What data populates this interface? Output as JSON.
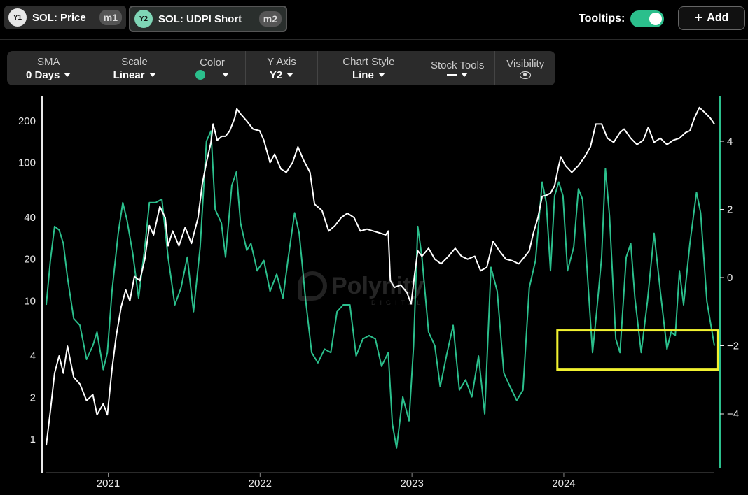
{
  "header": {
    "series1": {
      "badge": "Y1",
      "label": "SOL: Price",
      "metric": "m1"
    },
    "series2": {
      "badge": "Y2",
      "label": "SOL: UDPI Short",
      "metric": "m2"
    },
    "tooltips_label": "Tooltips:",
    "tooltips_on": true,
    "add_label": "Add",
    "add_icon": "plus-icon"
  },
  "controls": [
    {
      "label": "SMA",
      "value": "0 Days"
    },
    {
      "label": "Scale",
      "value": "Linear"
    },
    {
      "label": "Color",
      "value": ""
    },
    {
      "label": "Y Axis",
      "value": "Y2"
    },
    {
      "label": "Chart Style",
      "value": "Line"
    },
    {
      "label": "Stock Tools",
      "value": ""
    },
    {
      "label": "Visibility",
      "value": ""
    }
  ],
  "colors": {
    "accent": "#2bbf8c",
    "price_line": "#ffffff",
    "udpi_line": "#2bbf8c",
    "highlight_box": "#f2f230",
    "background": "#000000"
  },
  "watermark": {
    "text": "Polynity",
    "subtext": "DIGITAL"
  },
  "chart_data": {
    "type": "line",
    "x_ticks": [
      "2021",
      "2022",
      "2023",
      "2024"
    ],
    "y1_axis": {
      "scale": "log",
      "ticks": [
        "1",
        "2",
        "4",
        "10",
        "20",
        "40",
        "100",
        "200"
      ],
      "range": [
        0.85,
        300
      ]
    },
    "y2_axis": {
      "scale": "linear",
      "ticks": [
        "4",
        "2",
        "0",
        "-2",
        "-4"
      ],
      "range": [
        -5.5,
        5.3
      ]
    },
    "grid": false,
    "highlight": {
      "x_range": [
        "2023-12-25",
        "2024-11-25"
      ],
      "y2_range": [
        -2.7,
        -1.55
      ]
    },
    "series": [
      {
        "axis": "y1",
        "points": [
          [
            "2020-08-05",
            0.9
          ],
          [
            "2020-08-15",
            1.6
          ],
          [
            "2020-08-25",
            3.0
          ],
          [
            "2020-09-05",
            4.0
          ],
          [
            "2020-09-15",
            3.0
          ],
          [
            "2020-09-25",
            4.7
          ],
          [
            "2020-10-10",
            2.8
          ],
          [
            "2020-10-25",
            2.5
          ],
          [
            "2020-11-10",
            1.9
          ],
          [
            "2020-11-25",
            2.1
          ],
          [
            "2020-12-05",
            1.5
          ],
          [
            "2020-12-20",
            1.8
          ],
          [
            "2020-12-30",
            1.5
          ],
          [
            "2021-01-10",
            3.2
          ],
          [
            "2021-01-20",
            5.5
          ],
          [
            "2021-02-01",
            9.0
          ],
          [
            "2021-02-12",
            12.0
          ],
          [
            "2021-02-22",
            10.0
          ],
          [
            "2021-03-05",
            15.0
          ],
          [
            "2021-03-18",
            14.0
          ],
          [
            "2021-03-30",
            20.0
          ],
          [
            "2021-04-10",
            35.0
          ],
          [
            "2021-04-20",
            30.0
          ],
          [
            "2021-05-05",
            48.0
          ],
          [
            "2021-05-18",
            40.0
          ],
          [
            "2021-05-25",
            25.0
          ],
          [
            "2021-06-05",
            32.0
          ],
          [
            "2021-06-20",
            25.0
          ],
          [
            "2021-07-05",
            34.0
          ],
          [
            "2021-07-20",
            26.0
          ],
          [
            "2021-08-05",
            40.0
          ],
          [
            "2021-08-15",
            70.0
          ],
          [
            "2021-08-25",
            100.0
          ],
          [
            "2021-09-05",
            140.0
          ],
          [
            "2021-09-10",
            190.0
          ],
          [
            "2021-09-20",
            145.0
          ],
          [
            "2021-10-01",
            155.0
          ],
          [
            "2021-10-10",
            155.0
          ],
          [
            "2021-10-20",
            170.0
          ],
          [
            "2021-11-01",
            210.0
          ],
          [
            "2021-11-06",
            245.0
          ],
          [
            "2021-11-15",
            225.0
          ],
          [
            "2021-11-30",
            200.0
          ],
          [
            "2021-12-15",
            175.0
          ],
          [
            "2021-12-31",
            170.0
          ],
          [
            "2022-01-10",
            145.0
          ],
          [
            "2022-01-25",
            100.0
          ],
          [
            "2022-02-05",
            115.0
          ],
          [
            "2022-02-20",
            90.0
          ],
          [
            "2022-03-05",
            85.0
          ],
          [
            "2022-03-20",
            100.0
          ],
          [
            "2022-04-02",
            130.0
          ],
          [
            "2022-04-15",
            105.0
          ],
          [
            "2022-05-01",
            85.0
          ],
          [
            "2022-05-12",
            50.0
          ],
          [
            "2022-05-30",
            45.0
          ],
          [
            "2022-06-15",
            32.0
          ],
          [
            "2022-06-30",
            35.0
          ],
          [
            "2022-07-15",
            40.0
          ],
          [
            "2022-07-30",
            43.0
          ],
          [
            "2022-08-15",
            40.0
          ],
          [
            "2022-08-30",
            32.0
          ],
          [
            "2022-09-15",
            33.0
          ],
          [
            "2022-09-30",
            32.0
          ],
          [
            "2022-10-15",
            31.0
          ],
          [
            "2022-10-30",
            30.0
          ],
          [
            "2022-11-05",
            32.0
          ],
          [
            "2022-11-10",
            14.0
          ],
          [
            "2022-11-20",
            12.5
          ],
          [
            "2022-12-05",
            13.0
          ],
          [
            "2022-12-20",
            11.5
          ],
          [
            "2022-12-30",
            9.5
          ],
          [
            "2023-01-08",
            16.0
          ],
          [
            "2023-01-15",
            23.0
          ],
          [
            "2023-01-25",
            21.0
          ],
          [
            "2023-02-10",
            24.0
          ],
          [
            "2023-02-25",
            20.0
          ],
          [
            "2023-03-12",
            18.5
          ],
          [
            "2023-03-30",
            21.0
          ],
          [
            "2023-04-15",
            24.0
          ],
          [
            "2023-04-30",
            21.0
          ],
          [
            "2023-05-15",
            20.0
          ],
          [
            "2023-06-01",
            21.0
          ],
          [
            "2023-06-15",
            16.5
          ],
          [
            "2023-06-30",
            17.5
          ],
          [
            "2023-07-15",
            27.0
          ],
          [
            "2023-07-30",
            23.0
          ],
          [
            "2023-08-15",
            20.0
          ],
          [
            "2023-08-30",
            19.5
          ],
          [
            "2023-09-15",
            18.5
          ],
          [
            "2023-09-30",
            21.0
          ],
          [
            "2023-10-10",
            23.0
          ],
          [
            "2023-10-20",
            31.0
          ],
          [
            "2023-10-31",
            40.0
          ],
          [
            "2023-11-10",
            57.0
          ],
          [
            "2023-11-20",
            58.0
          ],
          [
            "2023-11-30",
            60.0
          ],
          [
            "2023-12-10",
            68.0
          ],
          [
            "2023-12-20",
            95.0
          ],
          [
            "2023-12-25",
            110.0
          ],
          [
            "2024-01-05",
            95.0
          ],
          [
            "2024-01-20",
            85.0
          ],
          [
            "2024-02-05",
            95.0
          ],
          [
            "2024-02-20",
            110.0
          ],
          [
            "2024-03-05",
            130.0
          ],
          [
            "2024-03-18",
            190.0
          ],
          [
            "2024-04-01",
            190.0
          ],
          [
            "2024-04-15",
            150.0
          ],
          [
            "2024-04-30",
            140.0
          ],
          [
            "2024-05-15",
            165.0
          ],
          [
            "2024-05-25",
            175.0
          ],
          [
            "2024-06-10",
            150.0
          ],
          [
            "2024-06-25",
            135.0
          ],
          [
            "2024-07-10",
            145.0
          ],
          [
            "2024-07-22",
            180.0
          ],
          [
            "2024-08-05",
            140.0
          ],
          [
            "2024-08-20",
            150.0
          ],
          [
            "2024-09-05",
            135.0
          ],
          [
            "2024-09-20",
            145.0
          ],
          [
            "2024-10-05",
            150.0
          ],
          [
            "2024-10-20",
            165.0
          ],
          [
            "2024-10-30",
            170.0
          ],
          [
            "2024-11-10",
            210.0
          ],
          [
            "2024-11-22",
            250.0
          ],
          [
            "2024-12-05",
            230.0
          ],
          [
            "2024-12-18",
            210.0
          ],
          [
            "2024-12-28",
            190.0
          ]
        ]
      },
      {
        "axis": "y2",
        "points": [
          [
            "2020-08-05",
            -0.8
          ],
          [
            "2020-08-15",
            0.5
          ],
          [
            "2020-08-25",
            1.5
          ],
          [
            "2020-09-05",
            1.4
          ],
          [
            "2020-09-15",
            1.0
          ],
          [
            "2020-09-25",
            0.0
          ],
          [
            "2020-10-10",
            -1.2
          ],
          [
            "2020-10-25",
            -1.4
          ],
          [
            "2020-11-10",
            -2.4
          ],
          [
            "2020-11-25",
            -2.0
          ],
          [
            "2020-12-05",
            -1.6
          ],
          [
            "2020-12-20",
            -2.7
          ],
          [
            "2020-12-30",
            -2.2
          ],
          [
            "2021-01-10",
            -0.4
          ],
          [
            "2021-01-25",
            1.3
          ],
          [
            "2021-02-05",
            2.2
          ],
          [
            "2021-02-15",
            1.7
          ],
          [
            "2021-03-01",
            0.7
          ],
          [
            "2021-03-15",
            -0.6
          ],
          [
            "2021-03-30",
            0.9
          ],
          [
            "2021-04-10",
            2.2
          ],
          [
            "2021-04-25",
            2.2
          ],
          [
            "2021-05-10",
            2.3
          ],
          [
            "2021-05-25",
            0.6
          ],
          [
            "2021-06-10",
            -0.8
          ],
          [
            "2021-06-25",
            -0.3
          ],
          [
            "2021-07-10",
            0.6
          ],
          [
            "2021-07-25",
            -1.0
          ],
          [
            "2021-08-10",
            0.9
          ],
          [
            "2021-08-25",
            4.0
          ],
          [
            "2021-09-05",
            4.3
          ],
          [
            "2021-09-15",
            2.0
          ],
          [
            "2021-09-30",
            1.6
          ],
          [
            "2021-10-10",
            0.6
          ],
          [
            "2021-10-25",
            2.7
          ],
          [
            "2021-11-05",
            3.1
          ],
          [
            "2021-11-15",
            1.6
          ],
          [
            "2021-11-30",
            0.8
          ],
          [
            "2021-12-10",
            1.0
          ],
          [
            "2021-12-25",
            0.2
          ],
          [
            "2022-01-10",
            0.5
          ],
          [
            "2022-01-25",
            -0.4
          ],
          [
            "2022-02-10",
            0.1
          ],
          [
            "2022-02-25",
            -0.6
          ],
          [
            "2022-03-10",
            0.6
          ],
          [
            "2022-03-25",
            1.9
          ],
          [
            "2022-04-05",
            1.3
          ],
          [
            "2022-04-20",
            -0.6
          ],
          [
            "2022-05-05",
            -2.2
          ],
          [
            "2022-05-20",
            -2.5
          ],
          [
            "2022-06-05",
            -2.1
          ],
          [
            "2022-06-20",
            -2.2
          ],
          [
            "2022-07-05",
            -1.0
          ],
          [
            "2022-07-20",
            -0.8
          ],
          [
            "2022-08-05",
            -0.8
          ],
          [
            "2022-08-20",
            -2.3
          ],
          [
            "2022-09-05",
            -1.8
          ],
          [
            "2022-09-20",
            -1.7
          ],
          [
            "2022-10-05",
            -1.8
          ],
          [
            "2022-10-20",
            -2.6
          ],
          [
            "2022-11-05",
            -2.2
          ],
          [
            "2022-11-15",
            -4.3
          ],
          [
            "2022-11-25",
            -5.0
          ],
          [
            "2022-12-10",
            -3.5
          ],
          [
            "2022-12-25",
            -4.2
          ],
          [
            "2023-01-05",
            -2.0
          ],
          [
            "2023-01-15",
            1.5
          ],
          [
            "2023-01-25",
            0.6
          ],
          [
            "2023-02-10",
            -1.6
          ],
          [
            "2023-02-25",
            -2.0
          ],
          [
            "2023-03-10",
            -3.2
          ],
          [
            "2023-03-25",
            -2.3
          ],
          [
            "2023-04-10",
            -1.4
          ],
          [
            "2023-04-25",
            -3.3
          ],
          [
            "2023-05-10",
            -3.0
          ],
          [
            "2023-05-25",
            -3.5
          ],
          [
            "2023-06-10",
            -2.3
          ],
          [
            "2023-06-25",
            -4.0
          ],
          [
            "2023-07-10",
            0.3
          ],
          [
            "2023-07-25",
            -0.4
          ],
          [
            "2023-08-10",
            -2.8
          ],
          [
            "2023-08-25",
            -3.2
          ],
          [
            "2023-09-10",
            -3.6
          ],
          [
            "2023-09-25",
            -3.3
          ],
          [
            "2023-10-10",
            -0.3
          ],
          [
            "2023-10-25",
            0.5
          ],
          [
            "2023-11-10",
            2.8
          ],
          [
            "2023-11-20",
            2.2
          ],
          [
            "2023-11-30",
            0.2
          ],
          [
            "2023-12-10",
            2.4
          ],
          [
            "2023-12-20",
            2.8
          ],
          [
            "2023-12-30",
            2.4
          ],
          [
            "2024-01-10",
            0.2
          ],
          [
            "2024-01-25",
            0.9
          ],
          [
            "2024-02-05",
            2.6
          ],
          [
            "2024-02-15",
            2.3
          ],
          [
            "2024-03-01",
            -0.5
          ],
          [
            "2024-03-10",
            -2.2
          ],
          [
            "2024-03-20",
            -1.0
          ],
          [
            "2024-04-01",
            0.6
          ],
          [
            "2024-04-10",
            3.2
          ],
          [
            "2024-04-20",
            1.8
          ],
          [
            "2024-05-05",
            -1.8
          ],
          [
            "2024-05-15",
            -2.2
          ],
          [
            "2024-05-30",
            0.6
          ],
          [
            "2024-06-10",
            1.0
          ],
          [
            "2024-06-20",
            -0.6
          ],
          [
            "2024-07-05",
            -2.2
          ],
          [
            "2024-07-20",
            -0.7
          ],
          [
            "2024-08-05",
            1.3
          ],
          [
            "2024-08-20",
            -0.4
          ],
          [
            "2024-09-05",
            -2.1
          ],
          [
            "2024-09-15",
            -1.6
          ],
          [
            "2024-09-25",
            -1.7
          ],
          [
            "2024-10-05",
            0.2
          ],
          [
            "2024-10-15",
            -0.8
          ],
          [
            "2024-10-30",
            1.0
          ],
          [
            "2024-11-15",
            2.5
          ],
          [
            "2024-11-25",
            1.9
          ],
          [
            "2024-12-10",
            -0.7
          ],
          [
            "2024-12-28",
            -2.0
          ]
        ]
      }
    ]
  }
}
